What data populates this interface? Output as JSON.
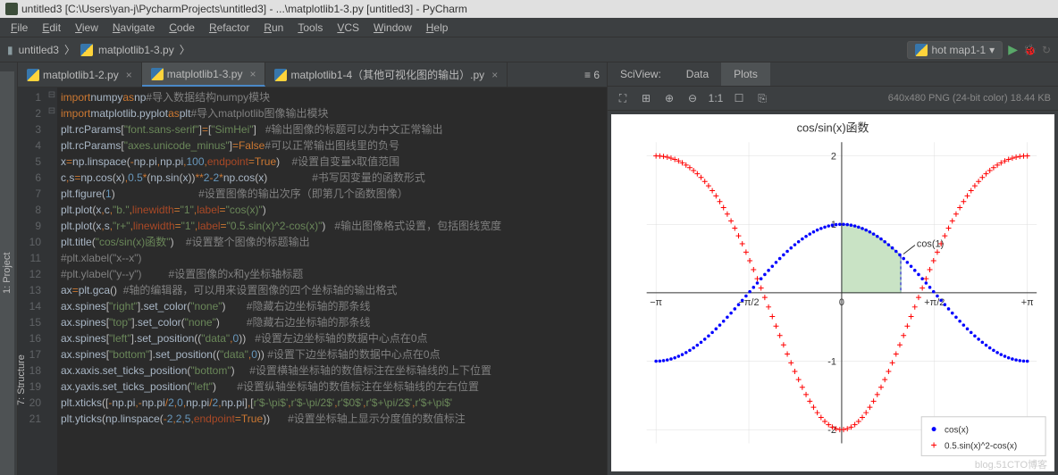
{
  "window": {
    "title": "untitled3 [C:\\Users\\yan-j\\PycharmProjects\\untitled3] - ...\\matplotlib1-3.py [untitled3] - PyCharm"
  },
  "menu": [
    "File",
    "Edit",
    "View",
    "Navigate",
    "Code",
    "Refactor",
    "Run",
    "Tools",
    "VCS",
    "Window",
    "Help"
  ],
  "breadcrumb": {
    "project": "untitled3",
    "file": "matplotlib1-3.py"
  },
  "run_config": "hot map1-1",
  "left_tabs": [
    "1: Project",
    "7: Structure"
  ],
  "editor_tabs": [
    {
      "label": "matplotlib1-2.py",
      "active": false
    },
    {
      "label": "matplotlib1-3.py",
      "active": true
    },
    {
      "label": "matplotlib1-4（其他可视化图的输出）.py",
      "active": false
    }
  ],
  "tabs_right_indicator": "≡ 6",
  "code_lines": [
    {
      "n": 1,
      "html": "<span class='kw'>import</span> <span class='id'>numpy</span> <span class='kw'>as</span> <span class='id'>np</span>              <span class='com'>#导入数据结构numpy模块</span>"
    },
    {
      "n": 2,
      "html": "<span class='kw'>import</span> <span class='id'>matplotlib.pyplot</span> <span class='kw'>as</span> <span class='id'>plt</span>    <span class='com'>#导入matplotlib图像输出模块</span>"
    },
    {
      "n": 3,
      "html": "<span class='id'>plt.rcParams</span>[<span class='str'>\"font.sans-serif\"</span>]<span class='kw'>=</span>[<span class='str'>\"SimHei\"</span>]   <span class='com'>#输出图像的标题可以为中文正常输出</span>"
    },
    {
      "n": 4,
      "html": "<span class='id'>plt.rcParams</span>[<span class='str'>\"axes.unicode_minus\"</span>]<span class='kw'>=False</span>    <span class='com'>#可以正常输出图线里的负号</span>"
    },
    {
      "n": 5,
      "html": "<span class='id'>x</span><span class='kw'>=</span><span class='id'>np.linspace</span>(<span class='kw'>-</span><span class='id'>np.pi</span><span class='kw'>,</span><span class='id'>np.pi</span><span class='kw'>,</span><span class='num'>100</span><span class='kw'>,</span><span class='param'>endpoint</span><span class='kw'>=True</span>)    <span class='com'>#设置自变量x取值范围</span>"
    },
    {
      "n": 6,
      "html": "<span class='id'>c</span><span class='kw'>,</span><span class='id'>s</span><span class='kw'>=</span><span class='id'>np.cos</span>(<span class='id'>x</span>)<span class='kw'>,</span><span class='num'>0.5</span><span class='kw'>*</span>(<span class='id'>np.sin</span>(<span class='id'>x</span>))<span class='kw'>**</span><span class='num'>2</span><span class='kw'>-</span><span class='num'>2</span><span class='kw'>*</span><span class='id'>np.cos</span>(<span class='id'>x</span>)               <span class='com'>#书写因变量的函数形式</span>"
    },
    {
      "n": 7,
      "html": "<span class='id'>plt.figure</span>(<span class='num'>1</span>)                            <span class='com'>#设置图像的输出次序（即第几个函数图像）</span>"
    },
    {
      "n": 8,
      "html": "<span class='id'>plt.plot</span>(<span class='id'>x</span><span class='kw'>,</span><span class='id'>c</span><span class='kw'>,</span><span class='str'>\"b.\"</span><span class='kw'>,</span><span class='param'>linewidth</span><span class='kw'>=</span><span class='str'>\"1\"</span><span class='kw'>,</span><span class='param'>label</span><span class='kw'>=</span><span class='str'>\"cos(x)\"</span>)"
    },
    {
      "n": 9,
      "html": "<span class='id'>plt.plot</span>(<span class='id'>x</span><span class='kw'>,</span><span class='id'>s</span><span class='kw'>,</span><span class='str'>\"r+\"</span><span class='kw'>,</span><span class='param'>linewidth</span><span class='kw'>=</span><span class='str'>\"1\"</span><span class='kw'>,</span><span class='param'>label</span><span class='kw'>=</span><span class='str'>\"0.5.sin(x)^2-cos(x)\"</span>)   <span class='com'>#输出图像格式设置，包括图线宽度</span>"
    },
    {
      "n": 10,
      "html": "<span class='id'>plt.title</span>(<span class='str'>\"cos/sin(x)函数\"</span>)    <span class='com'>#设置整个图像的标题输出</span>"
    },
    {
      "n": 11,
      "html": "<span class='com'>#plt.xlabel(\"x--x\")</span>"
    },
    {
      "n": 12,
      "html": "<span class='com'>#plt.ylabel(\"y--y\")         #设置图像的x和y坐标轴标题</span>"
    },
    {
      "n": 13,
      "html": "<span class='id'>ax</span><span class='kw'>=</span><span class='id'>plt.gca</span>()  <span class='com'>#轴的编辑器，可以用来设置图像的四个坐标轴的输出格式</span>"
    },
    {
      "n": 14,
      "html": "<span class='id'>ax.spines</span>[<span class='str'>\"right\"</span>].<span class='id'>set_color</span>(<span class='str'>\"none\"</span>)       <span class='com'>#隐藏右边坐标轴的那条线</span>"
    },
    {
      "n": 15,
      "html": "<span class='id'>ax.spines</span>[<span class='str'>\"top\"</span>].<span class='id'>set_color</span>(<span class='str'>\"none\"</span>)         <span class='com'>#隐藏右边坐标轴的那条线</span>"
    },
    {
      "n": 16,
      "html": "<span class='id'>ax.spines</span>[<span class='str'>\"left\"</span>].<span class='id'>set_position</span>((<span class='str'>\"data\"</span><span class='kw'>,</span><span class='num'>0</span>))   <span class='com'>#设置左边坐标轴的数据中心点在0点</span>"
    },
    {
      "n": 17,
      "html": "<span class='id'>ax.spines</span>[<span class='str'>\"bottom\"</span>].<span class='id'>set_position</span>((<span class='str'>\"data\"</span><span class='kw'>,</span><span class='num'>0</span>)) <span class='com'>#设置下边坐标轴的数据中心点在0点</span>"
    },
    {
      "n": 18,
      "html": "<span class='id'>ax.xaxis.set_ticks_position</span>(<span class='str'>\"bottom\"</span>)     <span class='com'>#设置横轴坐标轴的数值标注在坐标轴线的上下位置</span>"
    },
    {
      "n": 19,
      "html": "<span class='id'>ax.yaxis.set_ticks_position</span>(<span class='str'>\"left\"</span>)       <span class='com'>#设置纵轴坐标轴的数值标注在坐标轴线的左右位置</span>"
    },
    {
      "n": 20,
      "html": "<span class='id'>plt.xticks</span>([<span class='kw'>-</span><span class='id'>np.pi</span><span class='kw'>,-</span><span class='id'>np.pi</span><span class='kw'>/</span><span class='num'>2</span><span class='kw'>,</span><span class='num'>0</span><span class='kw'>,</span><span class='id'>np.pi</span><span class='kw'>/</span><span class='num'>2</span><span class='kw'>,</span><span class='id'>np.pi</span>]<span class='kw'>,</span>[<span class='str'>r'$-\\pi$'</span><span class='kw'>,</span><span class='str'>r'$-\\pi/2$'</span><span class='kw'>,</span><span class='str'>r'$0$'</span><span class='kw'>,</span><span class='str'>r'$+\\pi/2$'</span><span class='kw'>,</span><span class='str'>r'$+\\pi$'</span>"
    },
    {
      "n": 21,
      "html": "<span class='id'>plt.yticks</span>(<span class='id'>np.linspace</span>(<span class='kw'>-</span><span class='num'>2</span><span class='kw'>,</span><span class='num'>2</span><span class='kw'>,</span><span class='num'>5</span><span class='kw'>,</span><span class='param'>endpoint</span><span class='kw'>=True</span>))      <span class='com'>#设置坐标轴上显示分度值的数值标注</span>"
    }
  ],
  "sci_tabs": [
    {
      "label": "SciView:",
      "active": false
    },
    {
      "label": "Data",
      "active": false
    },
    {
      "label": "Plots",
      "active": true
    }
  ],
  "sci_toolbar": {
    "tools": [
      "⛶",
      "⊞",
      "⊕",
      "⊖",
      "1:1",
      "☐",
      "⎘"
    ],
    "info": "640x480 PNG (24-bit color) 18.44 KB"
  },
  "chart_data": {
    "type": "line",
    "title": "cos/sin(x)函数",
    "xlabel": "",
    "ylabel": "",
    "xticks": [
      {
        "v": -3.14159,
        "l": "−π"
      },
      {
        "v": -1.5708,
        "l": "−π/2"
      },
      {
        "v": 0,
        "l": "0"
      },
      {
        "v": 1.5708,
        "l": "+π/2"
      },
      {
        "v": 3.14159,
        "l": "+π"
      }
    ],
    "yticks": [
      -2,
      -1,
      0,
      1,
      2
    ],
    "xlim": [
      -3.3,
      3.3
    ],
    "ylim": [
      -2.2,
      2.2
    ],
    "series": [
      {
        "name": "cos(x)",
        "marker": "dot",
        "color": "#0000ff"
      },
      {
        "name": "0.5.sin(x)^2-cos(x)",
        "marker": "plus",
        "color": "#ff0000"
      }
    ],
    "annotation": {
      "label": "cos(1)",
      "x": 1,
      "y": 0.5403
    },
    "fill_region": {
      "x0": 0,
      "x1": 1,
      "color": "#c9e3c5"
    }
  },
  "watermark": "blog.51CTO博客"
}
